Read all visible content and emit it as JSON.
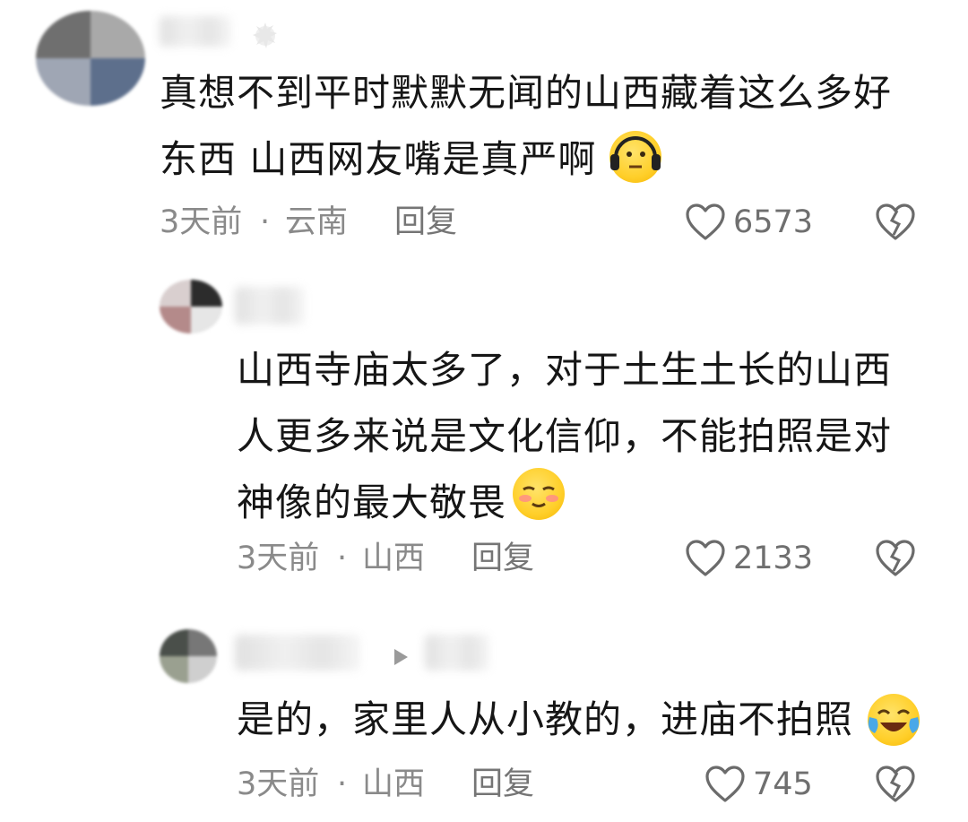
{
  "comments": [
    {
      "text_lines": [
        "真想不到平时默默无闻的山西藏着这么多好",
        "东西 山西网友嘴是真严啊"
      ],
      "time": "3天前",
      "location": "云南",
      "reply_label": "回复",
      "likes": "6573",
      "emoji": "headphones-shush-emoji"
    },
    {
      "text_lines": [
        "山西寺庙太多了，对于土生土长的山西",
        "人更多来说是文化信仰，不能拍照是对",
        "神像的最大敬畏"
      ],
      "time": "3天前",
      "location": "山西",
      "reply_label": "回复",
      "likes": "2133",
      "emoji": "blush-smile-emoji"
    },
    {
      "text_lines": [
        "是的，家里人从小教的，进庙不拍照"
      ],
      "time": "3天前",
      "location": "山西",
      "reply_label": "回复",
      "likes": "745",
      "emoji": "tears-of-joy-emoji"
    }
  ],
  "meta_separator": "·",
  "icons": {
    "like": "heart-outline-icon",
    "dislike": "broken-heart-icon",
    "reply_arrow": "play-triangle-icon"
  },
  "colors": {
    "text": "#161616",
    "meta": "#8a8a8a",
    "emoji": "#ffcf2a"
  }
}
